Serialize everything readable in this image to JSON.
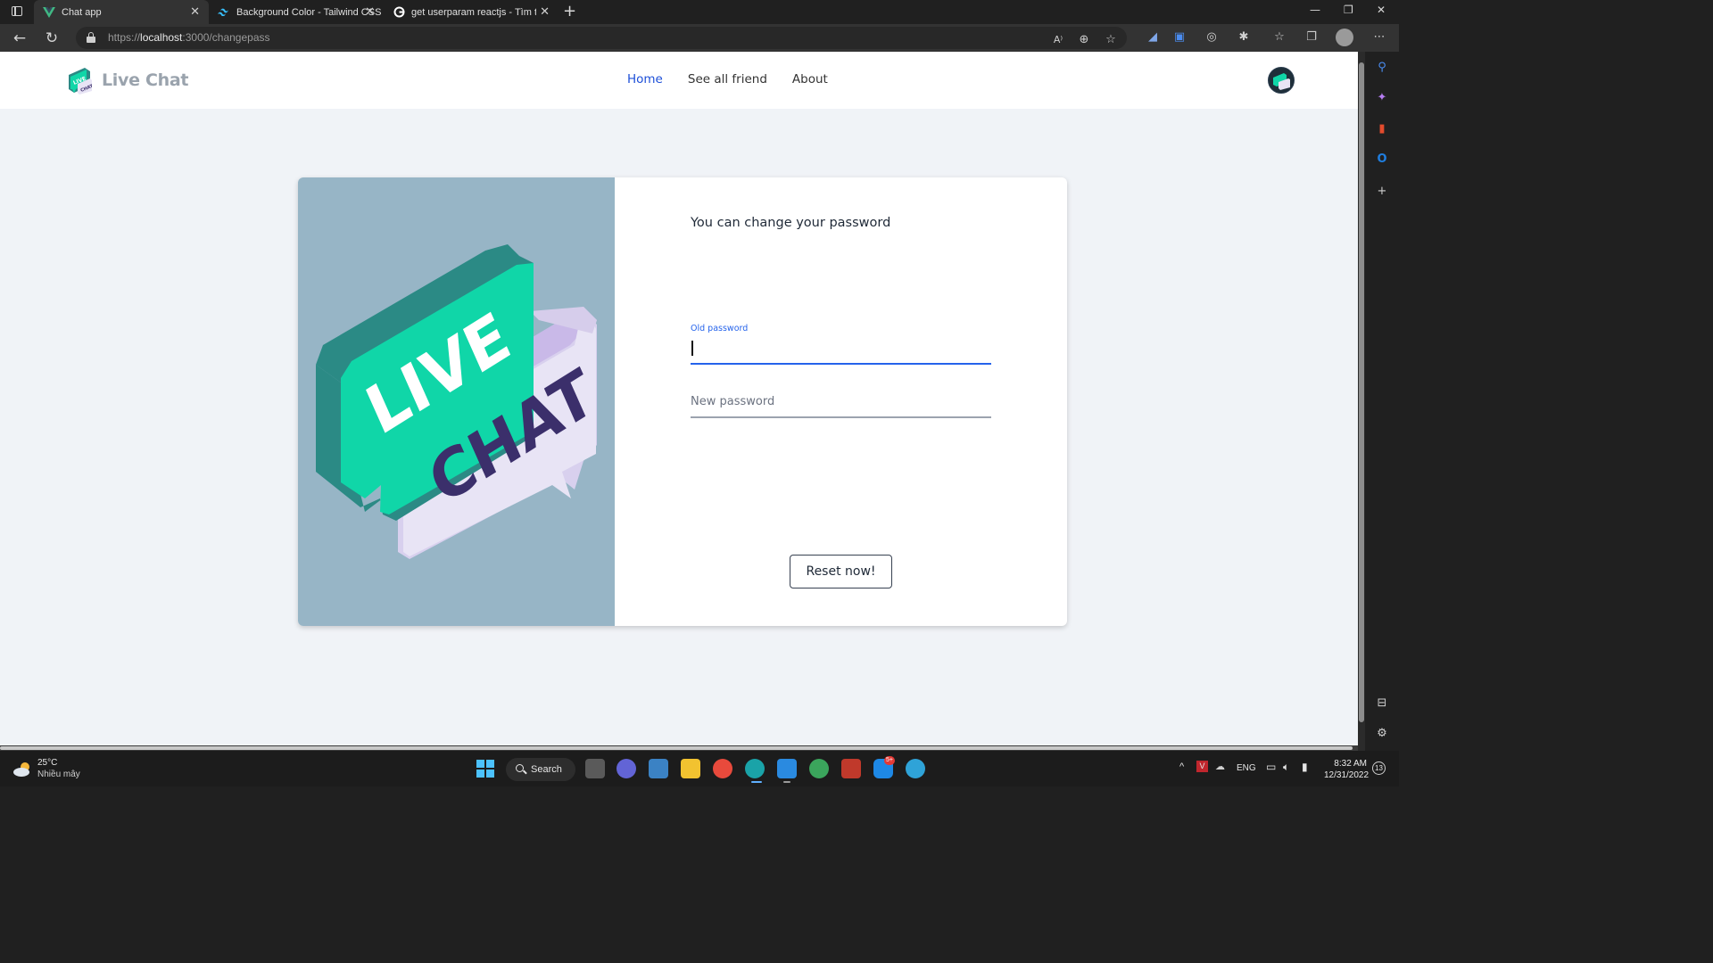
{
  "browser": {
    "tabs": [
      {
        "title": "Chat app",
        "favicon": "vue-icon",
        "active": true
      },
      {
        "title": "Background Color - Tailwind CSS",
        "favicon": "tailwind-icon",
        "active": false
      },
      {
        "title": "get userparam reactjs - Tìm trên",
        "favicon": "google-icon",
        "active": false
      }
    ],
    "url_scheme": "https://",
    "url_host": "localhost",
    "url_path": ":3000/changepass"
  },
  "app": {
    "brand_name": "Live Chat",
    "nav": [
      {
        "label": "Home",
        "active": true
      },
      {
        "label": "See all friend",
        "active": false
      },
      {
        "label": "About",
        "active": false
      }
    ],
    "illustration_text": {
      "line1": "LIVE",
      "line2": "CHAT"
    }
  },
  "form": {
    "title": "You can change your password",
    "old_password": {
      "label": "Old password",
      "value": ""
    },
    "new_password": {
      "placeholder": "New password",
      "value": ""
    },
    "submit_label": "Reset now!"
  },
  "taskbar": {
    "weather_temp": "25°C",
    "weather_cond": "Nhiều mây",
    "search_label": "Search",
    "lang": "ENG",
    "time": "8:32 AM",
    "date": "12/31/2022",
    "notification_count": "13",
    "zalo_badge": "5+"
  },
  "colors": {
    "accent": "#1d4fd8",
    "art_background": "#97b5c6",
    "bubble_green": "#10d6a8",
    "bubble_lavender": "#e8e4f5",
    "page_background": "#f0f3f7"
  }
}
